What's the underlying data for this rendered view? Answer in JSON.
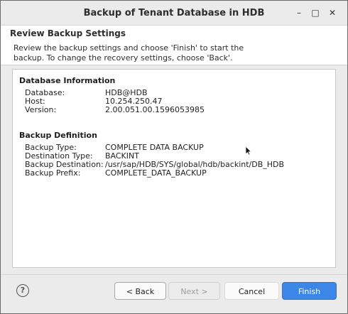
{
  "window": {
    "title": "Backup of Tenant Database in HDB",
    "controls": {
      "minimize": "–",
      "maximize": "□",
      "close": "✕"
    }
  },
  "page": {
    "title": "Review Backup Settings",
    "description": "Review the backup settings and choose 'Finish' to start the backup. To change the recovery settings, choose 'Back'."
  },
  "database_info": {
    "heading": "Database Information",
    "rows": [
      {
        "label": "Database:",
        "value": "HDB@HDB"
      },
      {
        "label": "Host:",
        "value": "10.254.250.47"
      },
      {
        "label": "Version:",
        "value": "2.00.051.00.1596053985"
      }
    ]
  },
  "backup_definition": {
    "heading": "Backup Definition",
    "rows": [
      {
        "label": "Backup Type:",
        "value": "COMPLETE DATA BACKUP"
      },
      {
        "label": "Destination Type:",
        "value": "BACKINT"
      },
      {
        "label": "Backup Destination:",
        "value": "/usr/sap/HDB/SYS/global/hdb/backint/DB_HDB"
      },
      {
        "label": "Backup Prefix:",
        "value": "COMPLETE_DATA_BACKUP"
      }
    ]
  },
  "footer": {
    "help_icon": "?",
    "back_label": "< Back",
    "next_label": "Next >",
    "cancel_label": "Cancel",
    "finish_label": "Finish"
  },
  "colors": {
    "accent": "#3b86e6",
    "dialog_bg": "#ebebeb",
    "panel_bg": "#ffffff"
  }
}
